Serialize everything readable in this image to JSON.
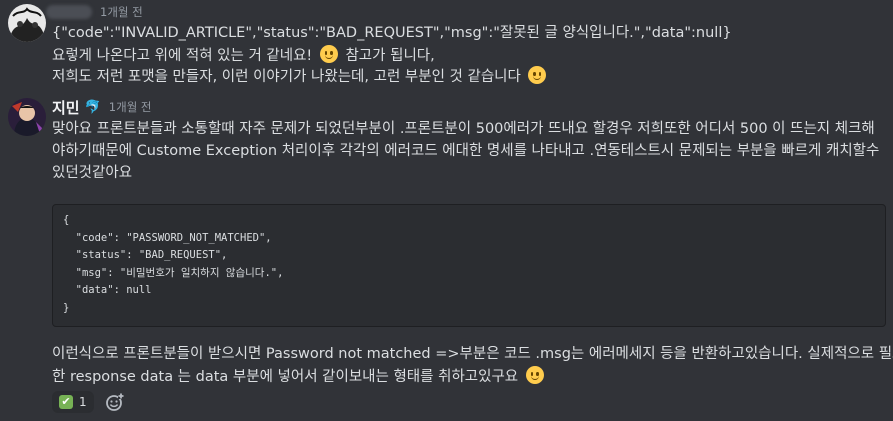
{
  "messages": [
    {
      "username": "",
      "timestamp": "1개월 전",
      "avatar_icon": "user-avatar-icon",
      "lines": [
        {
          "text": "{\"code\":\"INVALID_ARTICLE\",\"status\":\"BAD_REQUEST\",\"msg\":\"잘못된 글 양식입니다.\",\"data\":null}",
          "emoji_after": false
        },
        {
          "text": "요렇게 나온다고 위에 적혀 있는 거 같네요!",
          "emoji_after": true,
          "text_after": "참고가 됩니다,"
        },
        {
          "text": "저희도 저런 포맷을 만들자, 이런 이야기가 나왔는데, 고런 부분인 것 같습니다",
          "emoji_after": true
        }
      ]
    },
    {
      "username": "지민",
      "badge_icon": "dolphin-icon",
      "timestamp": "1개월 전",
      "avatar_icon": "user-avatar-icon",
      "lines": [
        "맞아요 프론트분들과 소통할때 자주 문제가 되었던부분이 .프론트분이 500에러가 뜨내요 할경우 저희또한 어디서 500 이 뜨는지 체크해",
        "야하기때문에 Custome Exception 처리이후 각각의 에러코드 에대한 명세를 나타내고 .연동테스트시 문제되는 부분을 빠르게 캐치할수",
        "있던것같아요"
      ],
      "code_lines": [
        "{",
        "  \"code\": \"PASSWORD_NOT_MATCHED\",",
        "  \"status\": \"BAD_REQUEST\",",
        "  \"msg\": \"비밀번호가 일치하지 않습니다.\",",
        "  \"data\": null",
        "}"
      ],
      "after_lines": [
        "이런식으로 프론트분들이 받으시면 Password not matched =>부분은 코드 .msg는 에러메세지 등을 반환하고있습니다. 실제적으로 필요",
        "한 response data 는 data 부분에 넣어서 같이보내는 형태를 취하고있구요"
      ],
      "reactions": [
        {
          "emoji": "✔",
          "emoji_name": "white-check-mark-icon",
          "count": "1"
        }
      ],
      "add_reaction_icon": "add-reaction-icon"
    }
  ]
}
